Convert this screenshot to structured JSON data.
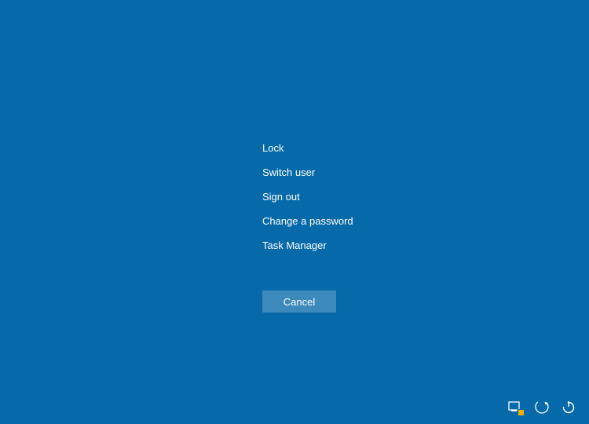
{
  "menu": {
    "items": [
      {
        "label": "Lock"
      },
      {
        "label": "Switch user"
      },
      {
        "label": "Sign out"
      },
      {
        "label": "Change a password"
      },
      {
        "label": "Task Manager"
      }
    ],
    "cancel_label": "Cancel"
  },
  "tray": {
    "network_icon": "network-icon",
    "ease_of_access_icon": "ease-of-access-icon",
    "power_icon": "power-icon"
  },
  "colors": {
    "background": "#0669a9",
    "text": "#ffffff",
    "button_bg": "rgba(255,255,255,0.22)",
    "badge": "#f0b000"
  }
}
